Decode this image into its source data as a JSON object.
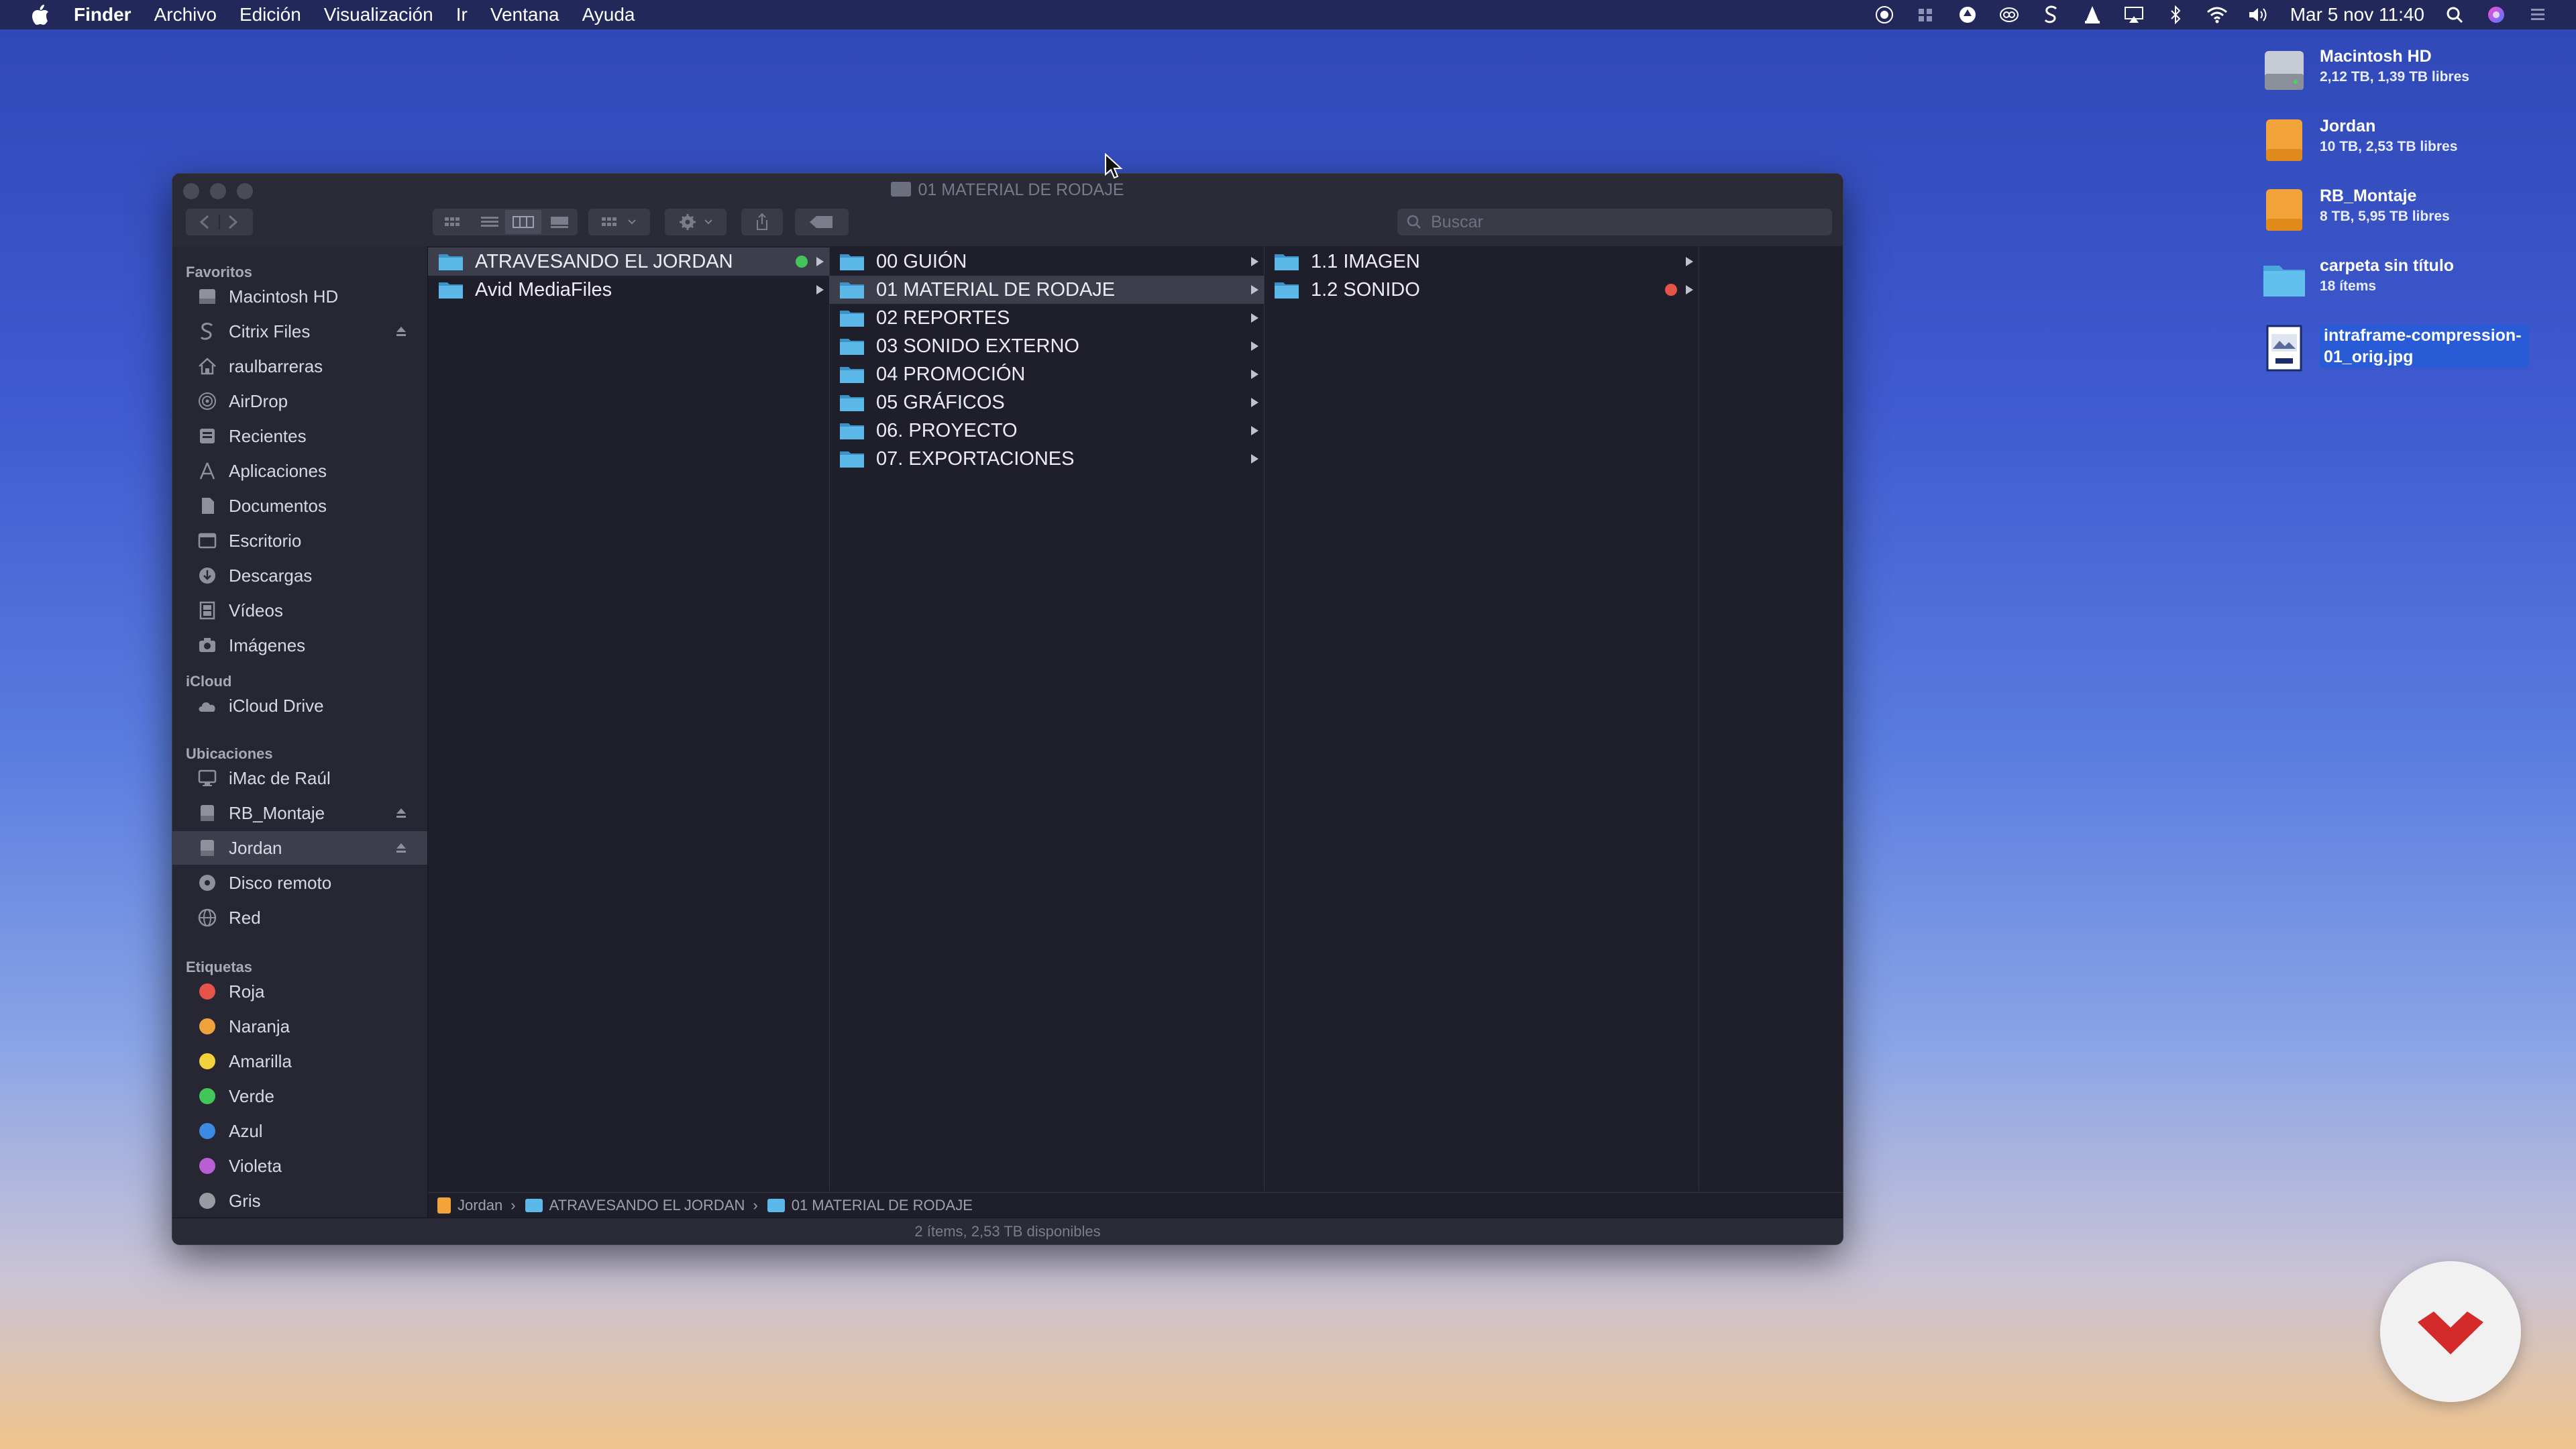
{
  "menubar": {
    "items": [
      "Finder",
      "Archivo",
      "Edición",
      "Visualización",
      "Ir",
      "Ventana",
      "Ayuda"
    ],
    "clock": "Mar 5 nov  11:40",
    "status_icons": [
      "screen-record-icon",
      "grid-icon",
      "upload-icon",
      "cc-icon",
      "citrix-icon",
      "vlc-icon",
      "airplay-icon",
      "bluetooth-icon",
      "wifi-icon",
      "volume-icon"
    ]
  },
  "desktop": [
    {
      "name": "Macintosh HD",
      "sub": "2,12 TB, 1,39 TB libres",
      "icon": "hard-drive-icon",
      "color": "#8a8f99"
    },
    {
      "name": "Jordan",
      "sub": "10 TB, 2,53 TB libres",
      "icon": "external-drive-icon",
      "color": "#f2a33a"
    },
    {
      "name": "RB_Montaje",
      "sub": "8 TB, 5,95 TB libres",
      "icon": "external-drive-icon",
      "color": "#f2a33a"
    },
    {
      "name": "carpeta sin título",
      "sub": "18 ítems",
      "icon": "folder-icon",
      "color": "#5bb8e8"
    },
    {
      "name": "intraframe-compression-01_orig.jpg",
      "sub": "",
      "icon": "jpg-file-icon",
      "color": "#ffffff"
    }
  ],
  "window": {
    "title": "01 MATERIAL DE RODAJE",
    "search_placeholder": "Buscar",
    "status": "2 ítems, 2,53 TB disponibles"
  },
  "sidebar": {
    "sections": [
      {
        "title": "Favoritos",
        "items": [
          {
            "label": "Macintosh HD",
            "icon": "hard-drive-icon"
          },
          {
            "label": "Citrix Files",
            "icon": "citrix-icon",
            "eject": true
          },
          {
            "label": "raulbarreras",
            "icon": "home-icon"
          },
          {
            "label": "AirDrop",
            "icon": "airdrop-icon"
          },
          {
            "label": "Recientes",
            "icon": "clock-icon"
          },
          {
            "label": "Aplicaciones",
            "icon": "apps-icon"
          },
          {
            "label": "Documentos",
            "icon": "document-icon"
          },
          {
            "label": "Escritorio",
            "icon": "desktop-icon"
          },
          {
            "label": "Descargas",
            "icon": "download-icon"
          },
          {
            "label": "Vídeos",
            "icon": "film-icon"
          },
          {
            "label": "Imágenes",
            "icon": "camera-icon"
          }
        ]
      },
      {
        "title": "iCloud",
        "items": [
          {
            "label": "iCloud Drive",
            "icon": "cloud-icon"
          }
        ]
      },
      {
        "title": "Ubicaciones",
        "items": [
          {
            "label": "iMac de Raúl",
            "icon": "imac-icon"
          },
          {
            "label": "RB_Montaje",
            "icon": "drive-icon",
            "eject": true
          },
          {
            "label": "Jordan",
            "icon": "drive-icon",
            "eject": true,
            "active": true
          },
          {
            "label": "Disco remoto",
            "icon": "disc-icon"
          },
          {
            "label": "Red",
            "icon": "network-icon"
          }
        ]
      },
      {
        "title": "Etiquetas",
        "tags": [
          {
            "label": "Roja",
            "color": "#e5534b"
          },
          {
            "label": "Naranja",
            "color": "#f0a23a"
          },
          {
            "label": "Amarilla",
            "color": "#f1d23a"
          },
          {
            "label": "Verde",
            "color": "#42c65a"
          },
          {
            "label": "Azul",
            "color": "#3b8be6"
          },
          {
            "label": "Violeta",
            "color": "#b85fd3"
          },
          {
            "label": "Gris",
            "color": "#9a9aa2"
          }
        ]
      }
    ]
  },
  "columns": [
    [
      {
        "label": "ATRAVESANDO EL JORDAN",
        "selected": true,
        "tag": "#42c65a"
      },
      {
        "label": "Avid MediaFiles",
        "selected": false
      }
    ],
    [
      {
        "label": "00 GUIÓN"
      },
      {
        "label": "01 MATERIAL DE RODAJE",
        "selected": true
      },
      {
        "label": "02 REPORTES"
      },
      {
        "label": "03 SONIDO EXTERNO"
      },
      {
        "label": "04 PROMOCIÓN"
      },
      {
        "label": "05 GRÁFICOS"
      },
      {
        "label": "06. PROYECTO"
      },
      {
        "label": "07. EXPORTACIONES"
      }
    ],
    [
      {
        "label": "1.1 IMAGEN"
      },
      {
        "label": "1.2 SONIDO",
        "tag": "#e5534b"
      }
    ],
    []
  ],
  "pathbar": [
    {
      "label": "Jordan",
      "color": "#f2a33a"
    },
    {
      "label": "ATRAVESANDO EL JORDAN",
      "color": "#5bb8e8"
    },
    {
      "label": "01 MATERIAL DE RODAJE",
      "color": "#5bb8e8"
    }
  ]
}
